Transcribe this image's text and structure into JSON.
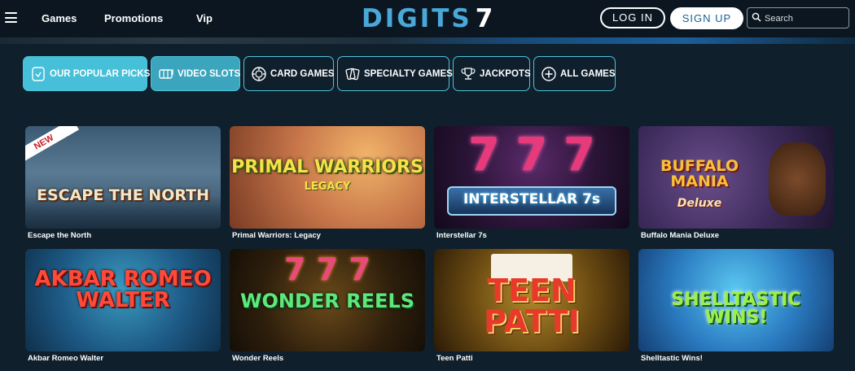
{
  "nav": {
    "games": "Games",
    "promotions": "Promotions",
    "vip": "Vip"
  },
  "logo": {
    "text": "DIGITS",
    "number": "7"
  },
  "auth": {
    "login": "LOG IN",
    "signup": "SIGN UP"
  },
  "search": {
    "placeholder": "Search"
  },
  "categories": [
    {
      "label": "OUR POPULAR PICKS",
      "icon": "hand-pointer-icon",
      "state": "active"
    },
    {
      "label": "VIDEO SLOTS",
      "icon": "slot-machine-icon",
      "state": "active"
    },
    {
      "label": "CARD GAMES",
      "icon": "poker-chip-icon",
      "state": "default"
    },
    {
      "label": "SPECIALTY GAMES",
      "icon": "cards-icon",
      "state": "default"
    },
    {
      "label": "JACKPOTS",
      "icon": "trophy-icon",
      "state": "default"
    },
    {
      "label": "ALL GAMES",
      "icon": "plus-circle-icon",
      "state": "default"
    }
  ],
  "games": [
    {
      "title": "Escape the North",
      "art": "ESCAPE THE NORTH",
      "badge": "NEW"
    },
    {
      "title": "Primal Warriors: Legacy",
      "art": "PRIMAL WARRIORS",
      "art_sub": "LEGACY"
    },
    {
      "title": "Interstellar 7s",
      "art": "INTERSTELLAR 7s"
    },
    {
      "title": "Buffalo Mania Deluxe",
      "art": "BUFFALO MANIA",
      "art_sub": "Deluxe"
    },
    {
      "title": "Akbar Romeo Walter",
      "art": "AKBAR ROMEO WALTER"
    },
    {
      "title": "Wonder Reels",
      "art": "WONDER REELS"
    },
    {
      "title": "Teen Patti",
      "art": "TEEN PATTI"
    },
    {
      "title": "Shelltastic Wins!",
      "art": "SHELLTASTIC WINS!"
    }
  ],
  "colors": {
    "background": "#0f1f2c",
    "accent": "#46bfd9",
    "signup_text": "#1f5f91"
  }
}
